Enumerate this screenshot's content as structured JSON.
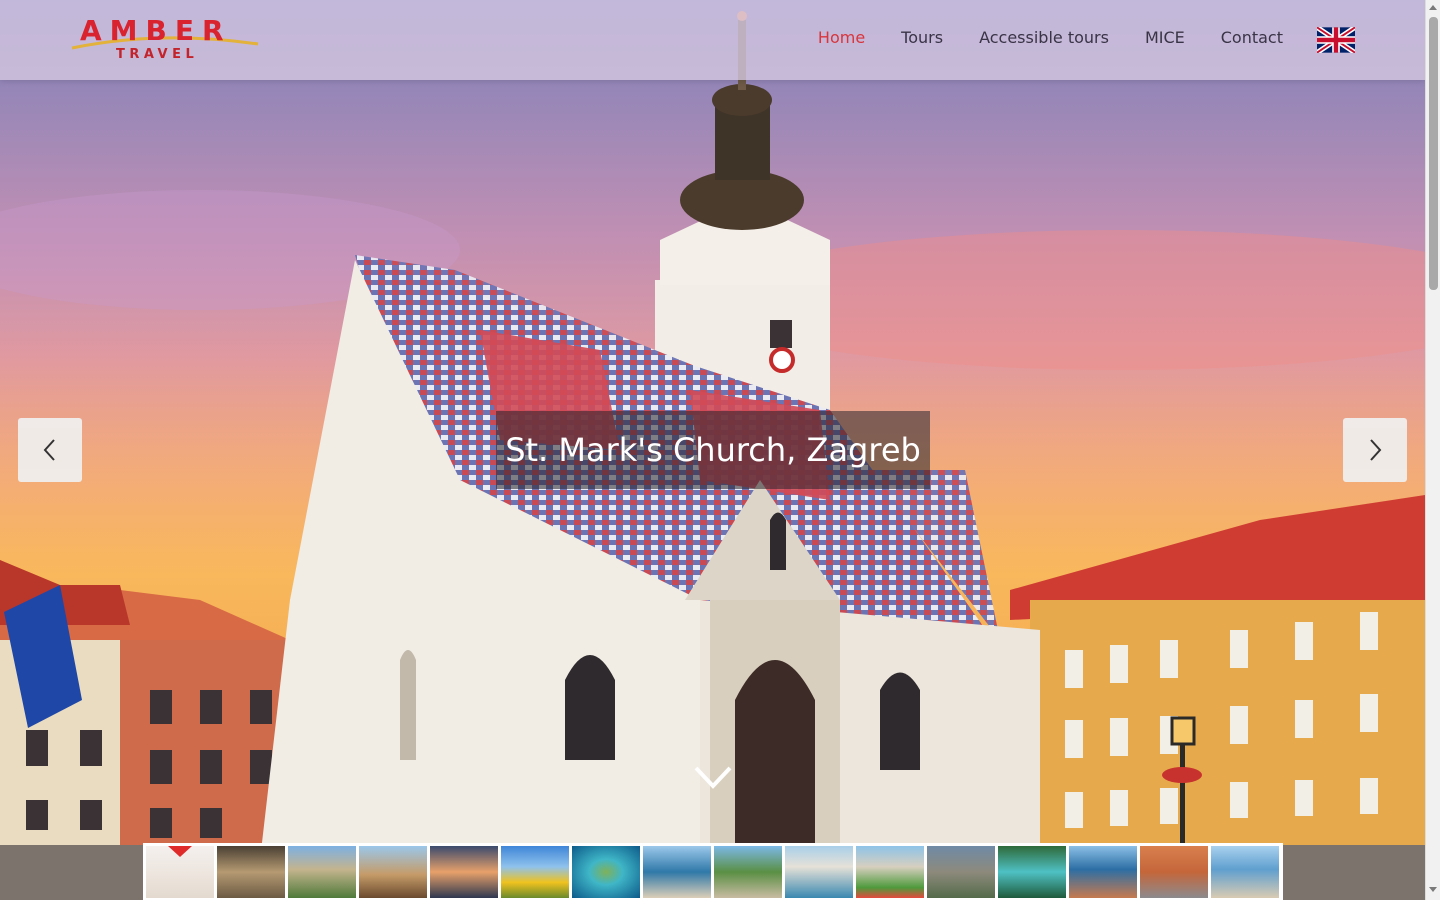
{
  "brand": {
    "name": "AMBER",
    "subtitle": "TRAVEL"
  },
  "nav": {
    "items": [
      {
        "label": "Home",
        "active": true
      },
      {
        "label": "Tours",
        "active": false
      },
      {
        "label": "Accessible tours",
        "active": false
      },
      {
        "label": "MICE",
        "active": false
      },
      {
        "label": "Contact",
        "active": false
      }
    ],
    "language_icon": "uk-flag-icon"
  },
  "slider": {
    "caption": "St. Mark's Church, Zagreb",
    "prev_icon": "chevron-left-icon",
    "next_icon": "chevron-right-icon",
    "scroll_icon": "chevron-down-icon",
    "active_thumbnail": 0,
    "thumbnail_count": 16
  },
  "colors": {
    "accent": "#d9353b",
    "brand_red": "#d9232e",
    "nav_text": "#3a3447"
  }
}
